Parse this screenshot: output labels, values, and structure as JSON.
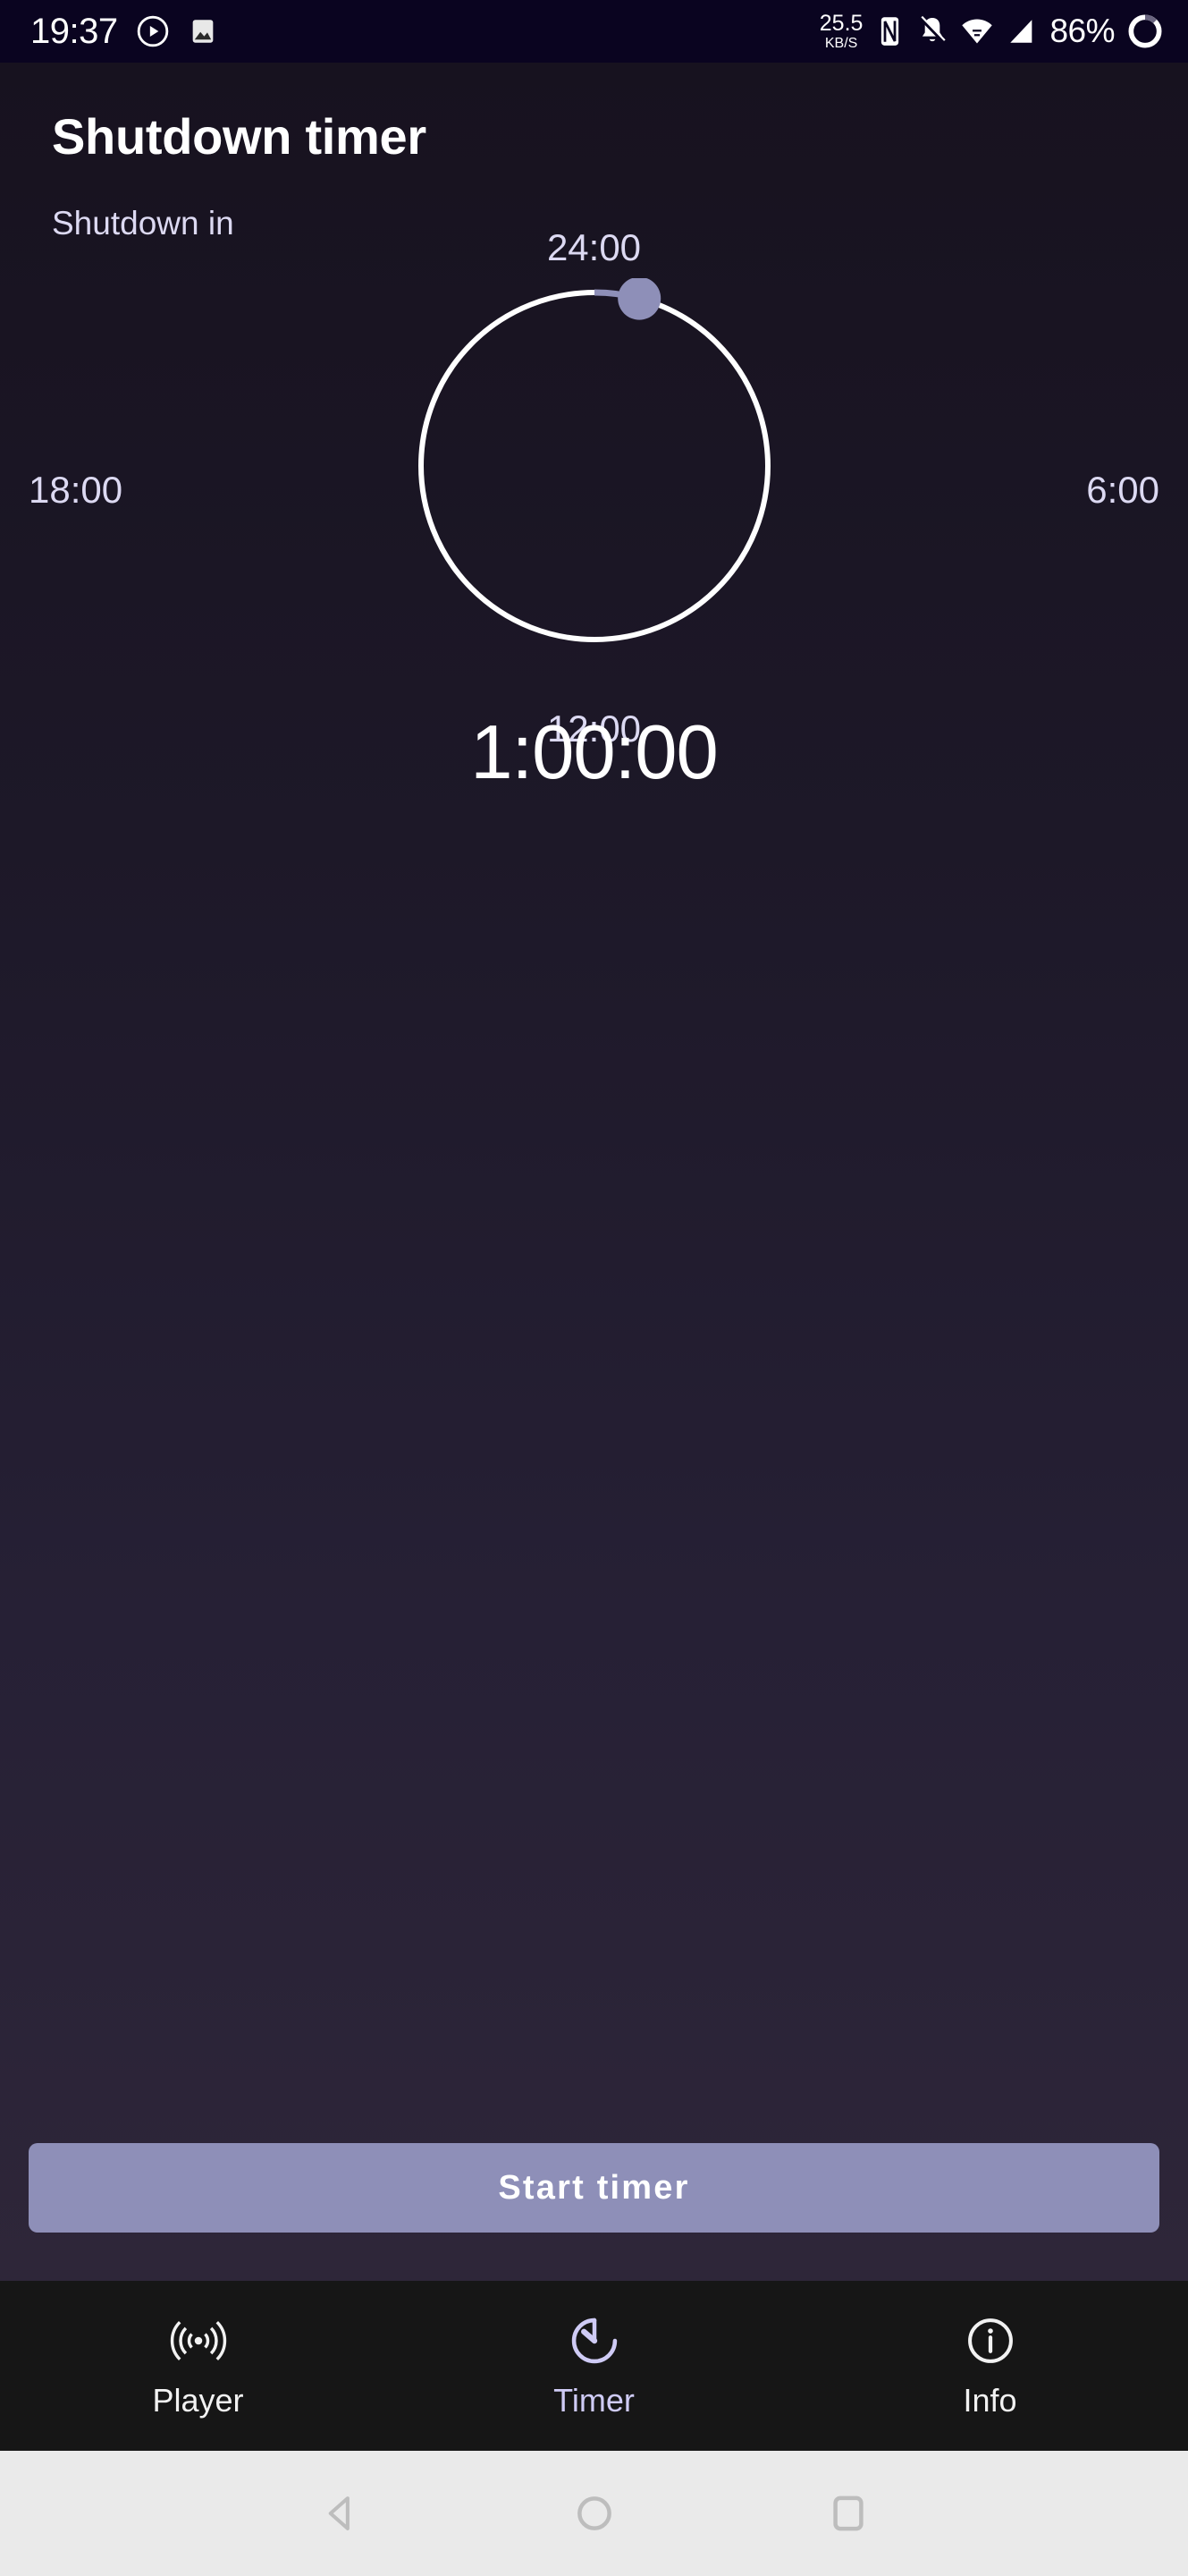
{
  "status_bar": {
    "time": "19:37",
    "left_icons": [
      "play-circle-icon",
      "image-icon"
    ],
    "network_speed_value": "25.5",
    "network_speed_unit": "KB/S",
    "right_icons": [
      "nfc-icon",
      "bell-muted-icon",
      "wifi-icon",
      "cell-signal-icon"
    ],
    "battery_percent": "86%",
    "battery_icon": "battery-circle-icon",
    "background_color": "#0a0420"
  },
  "header": {
    "title": "Shutdown timer",
    "subtitle": "Shutdown in"
  },
  "dial": {
    "value_display": "1:00:00",
    "mark_top": "24:00",
    "mark_right": "6:00",
    "mark_bottom": "12:00",
    "mark_left": "18:00",
    "track_color": "#ffffff",
    "progress_color": "#8e8fb8",
    "thumb_color": "#8e8fb8",
    "label_color": "#dcd9f2",
    "max_hours": 24,
    "selected_hours": 1,
    "progress_degrees": 15
  },
  "primary_action": {
    "label": "Start timer",
    "background_color": "#8e8fb8",
    "text_color": "#ffffff"
  },
  "bottom_nav": {
    "items": [
      {
        "label": "Player",
        "icon": "broadcast-icon",
        "active": false
      },
      {
        "label": "Timer",
        "icon": "timer-icon",
        "active": true
      },
      {
        "label": "Info",
        "icon": "info-circle-icon",
        "active": false
      }
    ],
    "active_color": "#cfcbf5",
    "inactive_color": "#f2f2f2",
    "background_color": "#161616"
  },
  "system_nav": {
    "buttons": [
      "back-icon",
      "home-icon",
      "recents-icon"
    ],
    "background_color": "#eaeaea",
    "icon_color": "#bdbdbd"
  }
}
